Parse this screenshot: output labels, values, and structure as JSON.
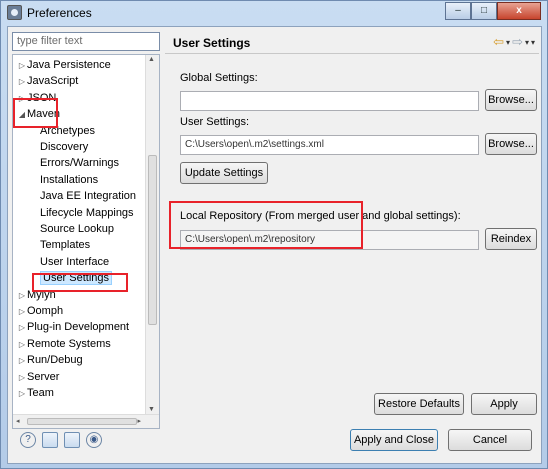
{
  "window": {
    "title": "Preferences",
    "controls": {
      "minimize": "–",
      "maximize": "□",
      "close": "x"
    }
  },
  "filter": {
    "placeholder": "type filter text"
  },
  "tree": {
    "items": [
      {
        "label": "Java Persistence",
        "twisty": "▷",
        "indent": 0
      },
      {
        "label": "JavaScript",
        "twisty": "▷",
        "indent": 0
      },
      {
        "label": "JSON",
        "twisty": "▷",
        "indent": 0
      },
      {
        "label": "Maven",
        "twisty": "◢",
        "indent": 0
      },
      {
        "label": "Archetypes",
        "twisty": "",
        "indent": 1
      },
      {
        "label": "Discovery",
        "twisty": "",
        "indent": 1
      },
      {
        "label": "Errors/Warnings",
        "twisty": "",
        "indent": 1
      },
      {
        "label": "Installations",
        "twisty": "",
        "indent": 1
      },
      {
        "label": "Java EE Integration",
        "twisty": "",
        "indent": 1
      },
      {
        "label": "Lifecycle Mappings",
        "twisty": "",
        "indent": 1
      },
      {
        "label": "Source Lookup",
        "twisty": "",
        "indent": 1
      },
      {
        "label": "Templates",
        "twisty": "",
        "indent": 1
      },
      {
        "label": "User Interface",
        "twisty": "",
        "indent": 1
      },
      {
        "label": "User Settings",
        "twisty": "",
        "indent": 1,
        "selected": true
      },
      {
        "label": "Mylyn",
        "twisty": "▷",
        "indent": 0
      },
      {
        "label": "Oomph",
        "twisty": "▷",
        "indent": 0
      },
      {
        "label": "Plug-in Development",
        "twisty": "▷",
        "indent": 0
      },
      {
        "label": "Remote Systems",
        "twisty": "▷",
        "indent": 0
      },
      {
        "label": "Run/Debug",
        "twisty": "▷",
        "indent": 0
      },
      {
        "label": "Server",
        "twisty": "▷",
        "indent": 0
      },
      {
        "label": "Team",
        "twisty": "▷",
        "indent": 0
      }
    ],
    "scroll": {
      "up": "▲",
      "down": "▼",
      "left": "◂",
      "right": "▸",
      "grip": "≡",
      "hgrip": "III"
    }
  },
  "page": {
    "title": "User Settings",
    "nav": {
      "back": "⇦",
      "forward": "⇨",
      "caret": "▾"
    },
    "global_settings_label": "Global Settings:",
    "global_settings_value": "",
    "user_settings_label": "User Settings:",
    "user_settings_value": "C:\\Users\\open\\.m2\\settings.xml",
    "browse_label": "Browse...",
    "update_settings_label": "Update Settings",
    "local_repo_label": "Local Repository (From merged user and global settings):",
    "local_repo_value": "C:\\Users\\open\\.m2\\repository",
    "reindex_label": "Reindex",
    "restore_defaults_label": "Restore Defaults",
    "apply_label": "Apply"
  },
  "footer": {
    "icons": [
      "help-icon",
      "import-icon",
      "export-icon",
      "record-icon"
    ],
    "help_glyph": "?",
    "record_glyph": "◉",
    "apply_close_label": "Apply and Close",
    "cancel_label": "Cancel"
  },
  "colors": {
    "annotation": "#e8222a",
    "selection": "#cde8ff",
    "nav_arrow": "#d59b2a"
  }
}
